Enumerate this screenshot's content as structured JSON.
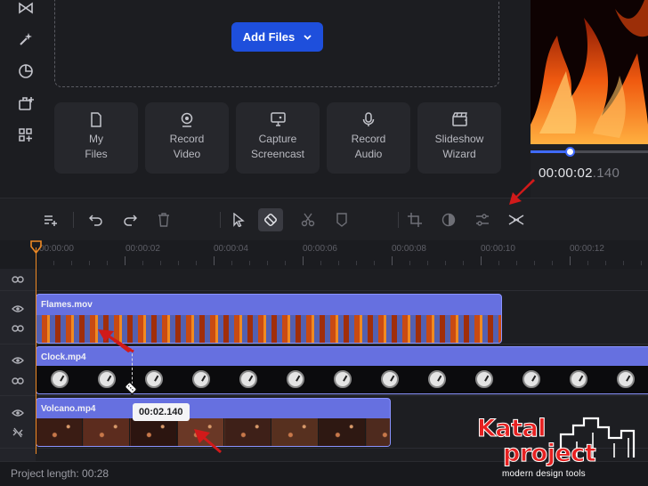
{
  "media": {
    "add_files_label": "Add Files",
    "tiles": [
      {
        "icon": "file-icon",
        "label": "My\nFiles"
      },
      {
        "icon": "webcam-icon",
        "label": "Record\nVideo"
      },
      {
        "icon": "screen-icon",
        "label": "Capture\nScreencast"
      },
      {
        "icon": "microphone-icon",
        "label": "Record\nAudio"
      },
      {
        "icon": "slideshow-icon",
        "label": "Slideshow\nWizard"
      }
    ]
  },
  "rail": {
    "icons": [
      "transitions-icon",
      "effects-icon",
      "stickers-icon",
      "export-icon",
      "more-tools-icon"
    ]
  },
  "preview": {
    "timecode_main": "00:00:02",
    "timecode_ms": ".140",
    "progress": 0.33
  },
  "toolbar": {
    "icons": [
      "add-track-icon",
      "undo-icon",
      "redo-icon",
      "delete-icon",
      "pointer-icon",
      "razor-icon",
      "cut-icon",
      "marker-icon",
      "crop-icon",
      "color-icon",
      "adjust-icon",
      "split-icon"
    ]
  },
  "timeline": {
    "ruler_labels": [
      "00:00:00",
      "00:00:02",
      "00:00:04",
      "00:00:06",
      "00:00:08",
      "00:00:10",
      "00:00:12"
    ],
    "clips": {
      "flames": "Flames.mov",
      "clock": "Clock.mp4",
      "volcano": "Volcano.mp4"
    },
    "cut_tooltip": "00:02.140"
  },
  "status": {
    "project_length": "Project length: 00:28"
  },
  "logo": {
    "line1": "Katal",
    "line2": "project",
    "tagline": "modern design tools"
  },
  "colors": {
    "accent": "#1e4fdc",
    "clip": "#6670e0",
    "playhead": "#f08a24",
    "annotation_arrow": "#d11a1a"
  }
}
